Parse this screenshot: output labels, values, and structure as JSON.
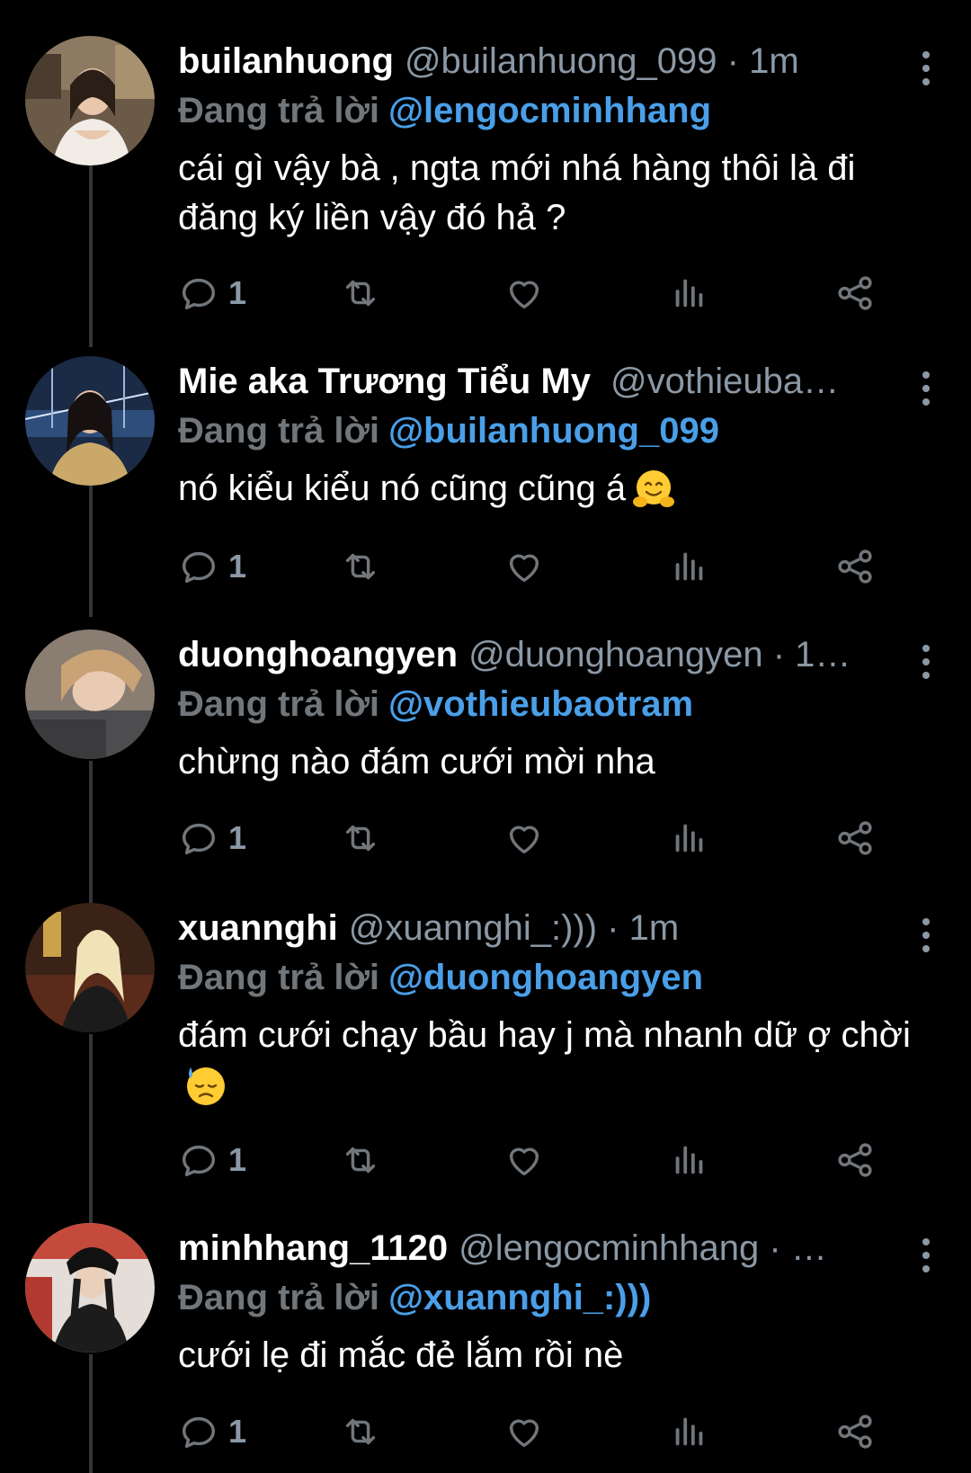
{
  "colors": {
    "background": "#000000",
    "name": "#ffffff",
    "secondary": "#8b98a5",
    "link": "#4a9fe8",
    "thread_line": "#333639"
  },
  "reply_prefix": "Đang trả lời",
  "tweets": [
    {
      "display_name": "builanhuong",
      "meta": "@builanhuong_099 · 1m",
      "reply_to": "@lengocminhhang",
      "text": "cái gì vậy bà , ngta mới nhá hàng thôi là đi đăng ký liền vậy đó hả ?",
      "emoji": "",
      "reply_count": "1",
      "avatar_icon": "profile-photo-woman-white-dress"
    },
    {
      "display_name": "Mie aka Trương Tiểu My",
      "meta": "@vothieuba…",
      "reply_to": "@builanhuong_099",
      "text": "nó kiểu kiểu nó cũng cũng á",
      "emoji": "hugging-face-emoji",
      "reply_count": "1",
      "avatar_icon": "profile-photo-woman-bridge-night"
    },
    {
      "display_name": "duonghoangyen",
      "meta": "@duonghoangyen · 1…",
      "reply_to": "@vothieubaotram",
      "text": "chừng nào đám cưới mời nha",
      "emoji": "",
      "reply_count": "1",
      "avatar_icon": "profile-photo-woman-lying"
    },
    {
      "display_name": "xuannghi",
      "meta": "@xuannghi_:))) · 1m",
      "reply_to": "@duonghoangyen",
      "text": "đám cưới chạy bầu hay j mà nhanh dữ ợ chời",
      "emoji": "downcast-face-with-sweat-emoji",
      "reply_count": "1",
      "avatar_icon": "profile-photo-blonde-woman"
    },
    {
      "display_name": "minhhang_1120",
      "meta": "@lengocminhhang · …",
      "reply_to": "@xuannghi_:)))",
      "text": "cưới lẹ đi mắc đẻ lắm rồi nè",
      "emoji": "",
      "reply_count": "1",
      "avatar_icon": "profile-photo-woman-black-jacket"
    }
  ],
  "action_icons": [
    "reply-icon",
    "retweet-icon",
    "like-icon",
    "views-icon",
    "share-icon"
  ]
}
